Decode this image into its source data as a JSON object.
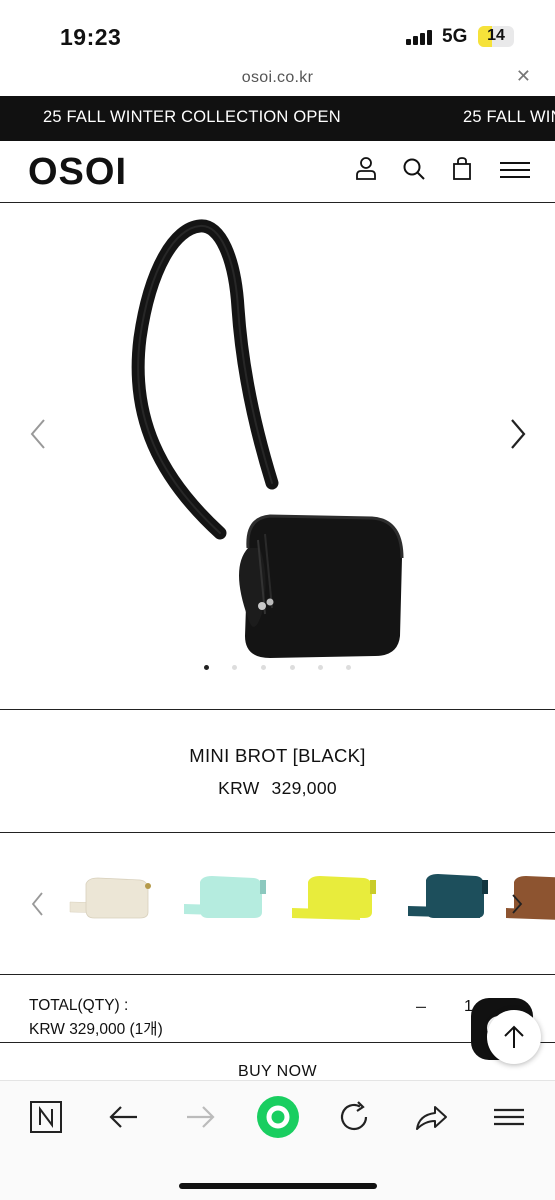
{
  "status_bar": {
    "time": "19:23",
    "network": "5G",
    "battery": "14"
  },
  "browser": {
    "url": "osoi.co.kr",
    "close_label": "✕"
  },
  "announcement": {
    "text": "25 FALL WINTER COLLECTION OPEN",
    "text_repeat": "25 FALL WIN"
  },
  "header": {
    "logo": "OSOI",
    "icons": [
      "user-icon",
      "search-icon",
      "shopping-bag-icon",
      "menu-icon"
    ]
  },
  "gallery": {
    "image_count": 6,
    "active_index": 0
  },
  "product": {
    "name": "MINI BROT [BLACK]",
    "currency": "KRW",
    "price": "329,000"
  },
  "color_swatches": [
    {
      "name": "ivory",
      "color": "#ece6d6"
    },
    {
      "name": "mint",
      "color": "#b5ecdf"
    },
    {
      "name": "yellow",
      "color": "#e8ec3c"
    },
    {
      "name": "teal",
      "color": "#1d4f5c"
    },
    {
      "name": "brown",
      "color": "#8d5430"
    }
  ],
  "total": {
    "label": "TOTAL(QTY) :",
    "amount": "KRW 329,000 (1개)",
    "minus": "–",
    "qty": "1"
  },
  "cta": {
    "buy_now": "BUY NOW"
  },
  "colors": {
    "accent_green": "#19ce60",
    "banner_bg": "#111111"
  }
}
